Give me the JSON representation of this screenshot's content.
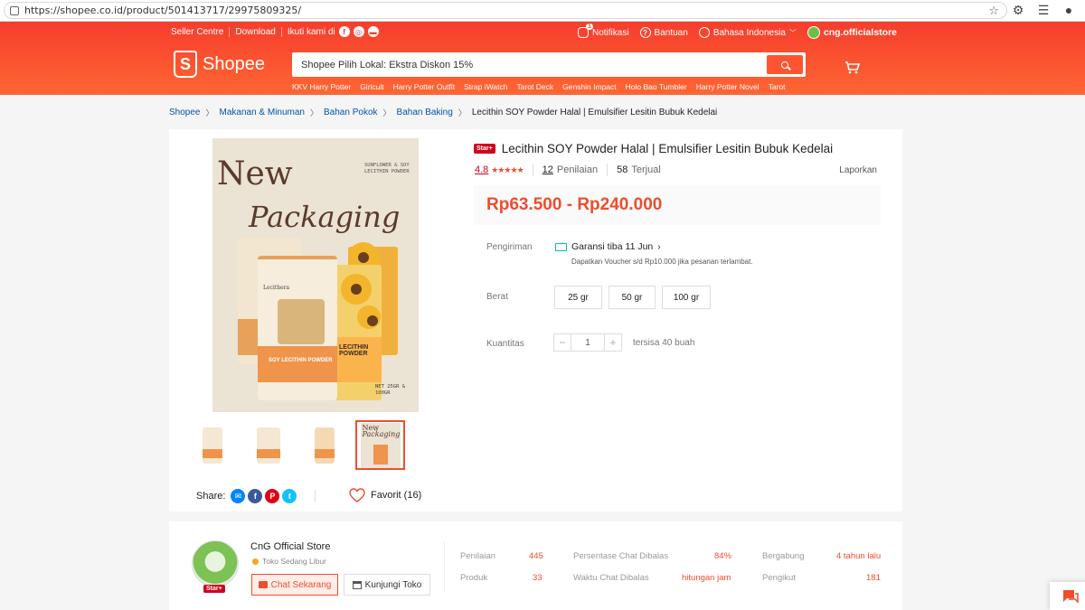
{
  "browser": {
    "url": "https://shopee.co.id/product/501413717/29975809325/"
  },
  "topnav": {
    "seller_centre": "Seller Centre",
    "download": "Download",
    "follow": "Ikuti kami di",
    "notification": "Notifikasi",
    "notification_count": "1",
    "help": "Bantuan",
    "language": "Bahasa Indonesia",
    "account": "cng.officialstore"
  },
  "logo": {
    "text": "Shopee"
  },
  "search": {
    "value": "Shopee Pilih Lokal: Ekstra Diskon 15%",
    "suggestions": [
      "KKV Harry Potter",
      "Girlcult",
      "Harry Potter Outfit",
      "Strap iWatch",
      "Tarot Deck",
      "Genshin Impact",
      "Holo Bao Tumbler",
      "Harry Potter Novel",
      "Tarot"
    ]
  },
  "breadcrumb": {
    "items": [
      "Shopee",
      "Makanan & Minuman",
      "Bahan Pokok",
      "Bahan Baking"
    ],
    "current": "Lecithin SOY Powder Halal | Emulsifier Lesitin Bubuk Kedelai"
  },
  "product_image": {
    "headline_1": "New",
    "headline_2": "Packaging",
    "subtitle": "SUNFLOWER & SOY LECITHIN POWDER",
    "brand": "Lecithera",
    "pack_label": "SOY LECITHIN POWDER",
    "side_label_1": "LECITHIN",
    "side_label_2": "POWDER",
    "net": "NET 25GR & 100GR",
    "thumb_headline_1": "New",
    "thumb_headline_2": "Packaging"
  },
  "share": {
    "label": "Share:"
  },
  "favorite": {
    "label": "Favorit (16)"
  },
  "product": {
    "badge": "Star+",
    "title": "Lecithin SOY Powder Halal | Emulsifier Lesitin Bubuk Kedelai",
    "rating": "4.8",
    "stars": "★★★★★",
    "reviews_count": "12",
    "reviews_label": "Penilaian",
    "sold_count": "58",
    "sold_label": "Terjual",
    "report": "Laporkan",
    "price": "Rp63.500 - Rp240.000"
  },
  "shipping": {
    "label": "Pengiriman",
    "guarantee": "Garansi tiba 11 Jun",
    "note": "Dapatkan Voucher s/d Rp10.000 jika pesanan terlambat."
  },
  "weight": {
    "label": "Berat",
    "options": [
      "25 gr",
      "50 gr",
      "100 gr"
    ]
  },
  "quantity": {
    "label": "Kuantitas",
    "minus": "−",
    "plus": "+",
    "value": "1",
    "stock": "tersisa 40 buah"
  },
  "store": {
    "badge": "Star+",
    "name": "CnG Official Store",
    "status": "Toko Sedang Libur",
    "chat_button": "Chat Sekarang",
    "visit_button": "Kunjungi Toko",
    "stats": [
      {
        "label": "Penilaian",
        "value": "445"
      },
      {
        "label": "Produk",
        "value": "33"
      },
      {
        "label": "Persentase Chat Dibalas",
        "value": "84%"
      },
      {
        "label": "Waktu Chat Dibalas",
        "value": "hitungan jam"
      },
      {
        "label": "Bergabung",
        "value": "4 tahun lalu"
      },
      {
        "label": "Pengikut",
        "value": "181"
      }
    ]
  },
  "colors": {
    "brand": "#ee4d2d",
    "header_start": "#f53d2d",
    "header_end": "#ff6633",
    "link": "#0055aa"
  }
}
